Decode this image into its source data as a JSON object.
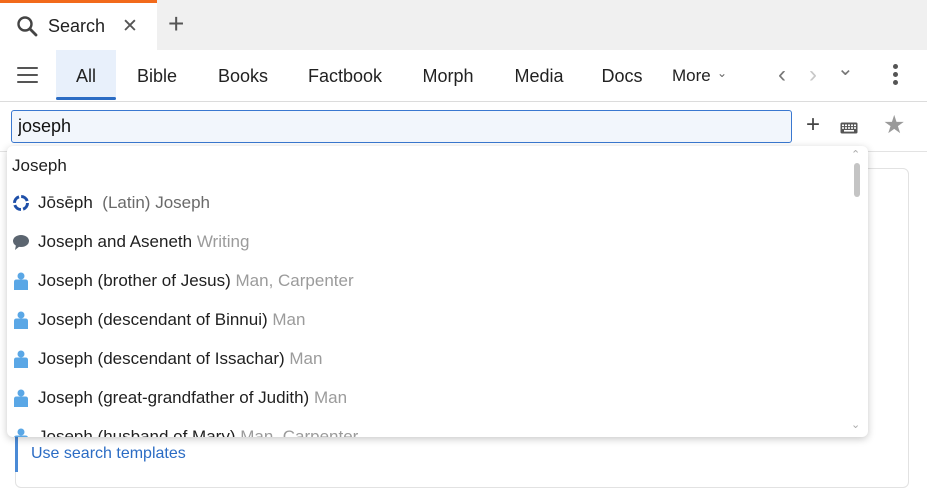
{
  "tab": {
    "label": "Search",
    "close": "✕",
    "new": "+"
  },
  "nav": {
    "tabs": [
      "All",
      "Bible",
      "Books",
      "Factbook",
      "Morph",
      "Media",
      "Docs"
    ],
    "more": "More",
    "back": "‹",
    "forward": "›",
    "history": "⌄"
  },
  "search": {
    "value": "joseph"
  },
  "toolbar": {
    "add": "+",
    "star": "★"
  },
  "dropdown": {
    "header": "Joseph",
    "items": [
      {
        "icon": "latin-lexicon-icon",
        "title": "Jōsēph",
        "meta": "(Latin) Joseph"
      },
      {
        "icon": "speech-bubble-icon",
        "title": "Joseph and Aseneth",
        "meta": "Writing"
      },
      {
        "icon": "person-icon",
        "title": "Joseph (brother of Jesus)",
        "meta": "Man, Carpenter"
      },
      {
        "icon": "person-icon",
        "title": "Joseph (descendant of Binnui)",
        "meta": "Man"
      },
      {
        "icon": "person-icon",
        "title": "Joseph (descendant of Issachar)",
        "meta": "Man"
      },
      {
        "icon": "person-icon",
        "title": "Joseph (great-grandfather of Judith)",
        "meta": "Man"
      },
      {
        "icon": "person-icon",
        "title": "Joseph (husband of Mary)",
        "meta": "Man, Carpenter"
      }
    ]
  },
  "templates_link": "Use search templates",
  "colors": {
    "accent": "#2b6cc4",
    "tab_top": "#f26a1b",
    "person": "#5aa7e6"
  }
}
